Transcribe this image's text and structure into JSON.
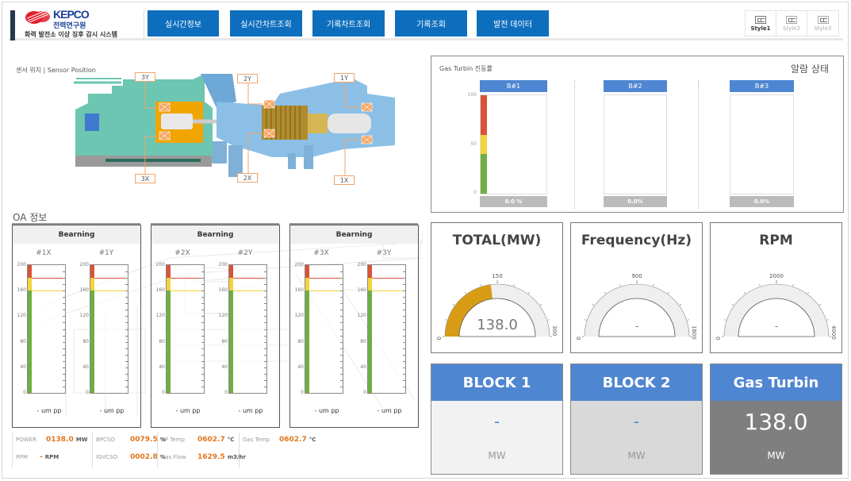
{
  "header": {
    "logo_en": "KEPCO",
    "logo_ko": "전력연구원",
    "system_title": "화력 발전소 이상 징후 감시 시스템",
    "nav": [
      "실시간정보",
      "실시간차트조회",
      "기록차트조회",
      "기록조회",
      "발전 데이터"
    ],
    "styles": [
      {
        "label": "Style1",
        "active": true
      },
      {
        "label": "Style2",
        "active": false
      },
      {
        "label": "Style3",
        "active": false
      }
    ]
  },
  "sensor_position": {
    "label": "센서 위치 | Sensor Position",
    "tags": [
      "3Y",
      "3X",
      "2Y",
      "2X",
      "1Y",
      "1X"
    ]
  },
  "oa": {
    "title": "OA 정보",
    "panels": [
      {
        "title": "Bearning",
        "gauges": [
          {
            "name": "#1X",
            "value": "-",
            "unit": "um pp"
          },
          {
            "name": "#1Y",
            "value": "-",
            "unit": "um pp"
          }
        ]
      },
      {
        "title": "Bearning",
        "gauges": [
          {
            "name": "#2X",
            "value": "-",
            "unit": "um pp"
          },
          {
            "name": "#2Y",
            "value": "-",
            "unit": "um pp"
          }
        ]
      },
      {
        "title": "Bearning",
        "gauges": [
          {
            "name": "#3X",
            "value": "-",
            "unit": "um pp"
          },
          {
            "name": "#3Y",
            "value": "-",
            "unit": "um pp"
          }
        ]
      }
    ],
    "scale": {
      "min": 0,
      "max": 200,
      "ticks": [
        "200",
        "160",
        "120",
        "80",
        "40",
        "0"
      ],
      "alarm": 180,
      "warning": 160
    },
    "colors": {
      "danger": "#d9533a",
      "warning": "#f2d43c",
      "normal": "#6fae45"
    }
  },
  "stats": [
    [
      {
        "label": "POWER",
        "value": "0138.0",
        "unit": "MW"
      },
      {
        "label": "RPM",
        "value": "-",
        "unit": "RPM"
      }
    ],
    [
      {
        "label": "BPCSO",
        "value": "0079.5",
        "unit": "%"
      },
      {
        "label": "IGVCSO",
        "value": "0002.8",
        "unit": "%"
      }
    ],
    [
      {
        "label": "BP Temp",
        "value": "0602.7",
        "unit": "°C"
      },
      {
        "label": "Gas Flow",
        "value": "1629.5",
        "unit": "m3/hr"
      }
    ],
    [
      {
        "label": "Gas Temp",
        "value": "0602.7",
        "unit": "°C"
      }
    ]
  ],
  "alarm": {
    "subtitle": "Gas Turbin 진동률",
    "title": "알람 상태",
    "axis": [
      "100",
      "50",
      "0"
    ],
    "bearings": [
      {
        "label": "B#1",
        "value": "0.0 %"
      },
      {
        "label": "B#2",
        "value": "0.0%"
      },
      {
        "label": "B#3",
        "value": "0.0%"
      }
    ]
  },
  "gauges": [
    {
      "title": "TOTAL(MW)",
      "min": "0",
      "mid": "150",
      "max": "300",
      "value": "138.0",
      "fraction": 0.46,
      "fill": "#d89c14"
    },
    {
      "title": "Frequency(Hz)",
      "min": "0",
      "mid": "900",
      "max": "1800",
      "value": "-",
      "fraction": 0,
      "fill": "#d89c14"
    },
    {
      "title": "RPM",
      "min": "0",
      "mid": "2000",
      "max": "4000",
      "value": "-",
      "fraction": 0,
      "fill": "#d89c14"
    }
  ],
  "blocks": [
    {
      "title": "BLOCK 1",
      "value": "-",
      "unit": "MW"
    },
    {
      "title": "BLOCK 2",
      "value": "-",
      "unit": "MW"
    },
    {
      "title": "Gas Turbin",
      "value": "138.0",
      "unit": "MW"
    }
  ]
}
